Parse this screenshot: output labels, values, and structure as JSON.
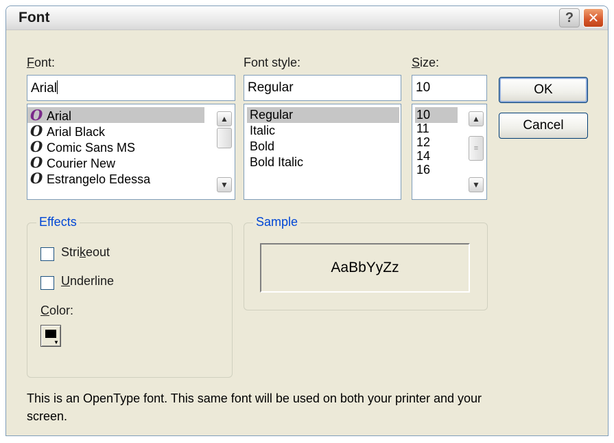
{
  "window": {
    "title": "Font",
    "help_label": "?",
    "close_label": "✕"
  },
  "font": {
    "label_underlined": "F",
    "label_rest": "ont:",
    "value": "Arial",
    "items": [
      "Arial",
      "Arial Black",
      "Comic Sans MS",
      "Courier New",
      "Estrangelo Edessa"
    ],
    "selected": "Arial",
    "icon_glyph": "O"
  },
  "style": {
    "label": "Font style:",
    "value": "Regular",
    "items": [
      "Regular",
      "Italic",
      "Bold",
      "Bold Italic"
    ],
    "selected": "Regular"
  },
  "size": {
    "label_underlined": "S",
    "label_rest": "ize:",
    "value": "10",
    "items": [
      "10",
      "11",
      "12",
      "14",
      "16"
    ],
    "selected": "10"
  },
  "buttons": {
    "ok": "OK",
    "cancel": "Cancel"
  },
  "effects": {
    "title": "Effects",
    "strikeout_pre": "Stri",
    "strikeout_u": "k",
    "strikeout_post": "eout",
    "underline_u": "U",
    "underline_post": "nderline",
    "strikeout_checked": false,
    "underline_checked": false,
    "color_label_u": "C",
    "color_label_rest": "olor:",
    "color_value": "#000000"
  },
  "sample": {
    "title": "Sample",
    "text": "AaBbYyZz"
  },
  "note": "This is an OpenType font. This same font will be used on both your printer and your screen.",
  "icons": {
    "scroll_up": "up-arrow-icon",
    "scroll_down": "down-arrow-icon",
    "opentype": "opentype-font-icon"
  }
}
